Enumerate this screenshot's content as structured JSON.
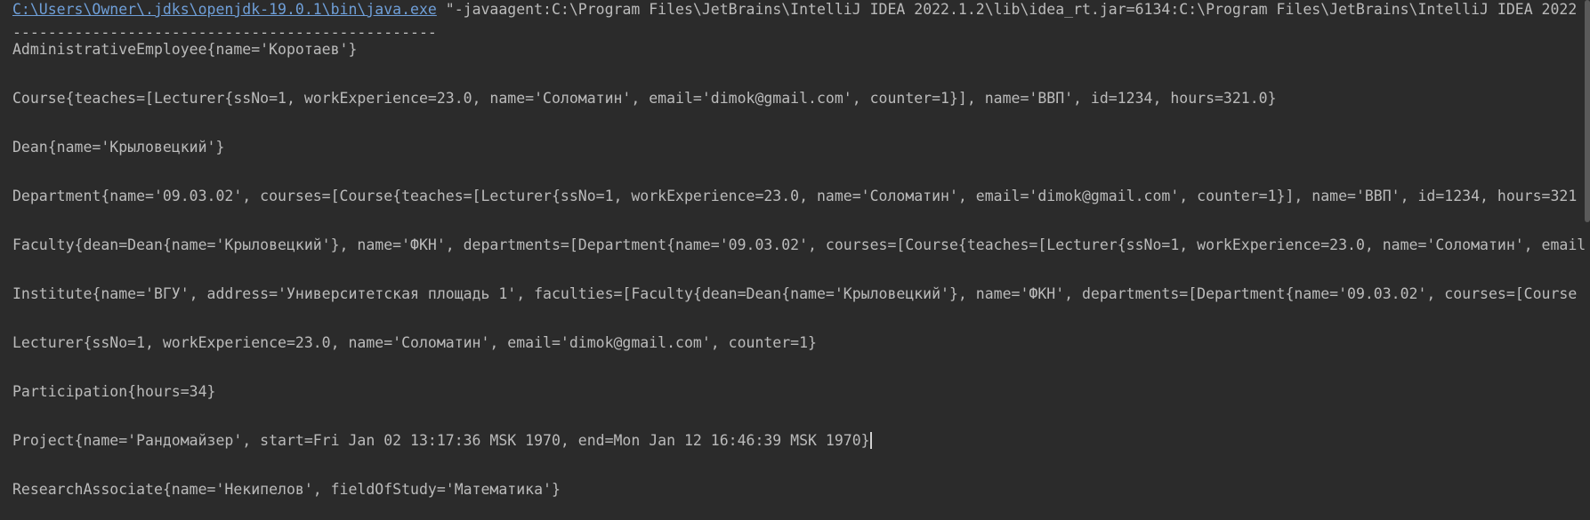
{
  "console": {
    "command": {
      "exe_path": "C:\\Users\\Owner\\.jdks\\openjdk-19.0.1\\bin\\java.exe",
      "args": " \"-javaagent:C:\\Program Files\\JetBrains\\IntelliJ IDEA 2022.1.2\\lib\\idea_rt.jar=6134:C:\\Program Files\\JetBrains\\IntelliJ IDEA 2022"
    },
    "separator": "------------------------------------------------",
    "lines": [
      "AdministrativeEmployee{name='Коротаев'}",
      "Course{teaches=[Lecturer{ssNo=1, workExperience=23.0, name='Соломатин', email='dimok@gmail.com', counter=1}], name='ВВП', id=1234, hours=321.0}",
      "Dean{name='Крыловецкий'}",
      "Department{name='09.03.02', courses=[Course{teaches=[Lecturer{ssNo=1, workExperience=23.0, name='Соломатин', email='dimok@gmail.com', counter=1}], name='ВВП', id=1234, hours=321",
      "Faculty{dean=Dean{name='Крыловецкий'}, name='ФКН', departments=[Department{name='09.03.02', courses=[Course{teaches=[Lecturer{ssNo=1, workExperience=23.0, name='Соломатин', email",
      "Institute{name='ВГУ', address='Университетская площадь 1', faculties=[Faculty{dean=Dean{name='Крыловецкий'}, name='ФКН', departments=[Department{name='09.03.02', courses=[Course",
      "Lecturer{ssNo=1, workExperience=23.0, name='Соломатин', email='dimok@gmail.com', counter=1}",
      "Participation{hours=34}",
      "Project{name='Рандомайзер', start=Fri Jan 02 13:17:36 MSK 1970, end=Mon Jan 12 16:46:39 MSK 1970}",
      "ResearchAssociate{name='Некипелов', fieldOfStudy='Математика'}"
    ]
  },
  "colors": {
    "background": "#2b2b2b",
    "text": "#bbbbbb",
    "link": "#6f9fd8"
  }
}
